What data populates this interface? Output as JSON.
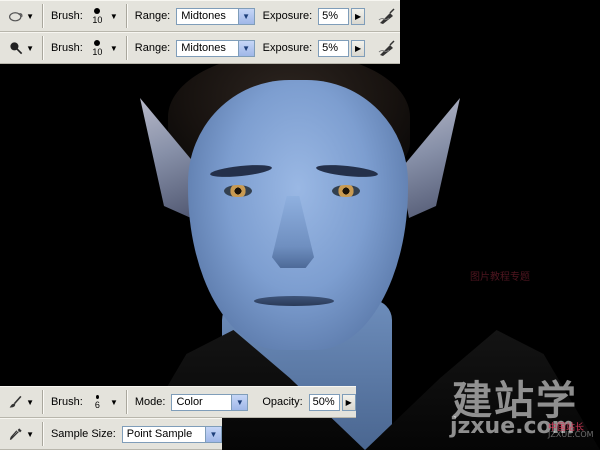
{
  "toolbars": [
    {
      "tool_icon": "burn-tool-icon",
      "brush_label": "Brush:",
      "brush_size": "10",
      "range_label": "Range:",
      "range_value": "Midtones",
      "exposure_label": "Exposure:",
      "exposure_value": "5%",
      "airbrush_icon": "airbrush-icon"
    },
    {
      "tool_icon": "dodge-tool-icon",
      "brush_label": "Brush:",
      "brush_size": "10",
      "range_label": "Range:",
      "range_value": "Midtones",
      "exposure_label": "Exposure:",
      "exposure_value": "5%",
      "airbrush_icon": "airbrush-icon"
    },
    {
      "tool_icon": "brush-tool-icon",
      "brush_label": "Brush:",
      "brush_size": "6",
      "mode_label": "Mode:",
      "mode_value": "Color",
      "opacity_label": "Opacity:",
      "opacity_value": "50%"
    },
    {
      "tool_icon": "eyedropper-tool-icon",
      "sample_label": "Sample Size:",
      "sample_value": "Point Sample"
    }
  ],
  "watermark": {
    "chinese": "建站学",
    "url": "jzxue.com",
    "red_text": "中国站长",
    "small_text": "JZXUE.COM",
    "faint_text": "图片教程专题"
  },
  "colors": {
    "toolbar_bg": "#e4e3dc",
    "field_border": "#7f9db9",
    "skin": "#7d9ed0"
  }
}
